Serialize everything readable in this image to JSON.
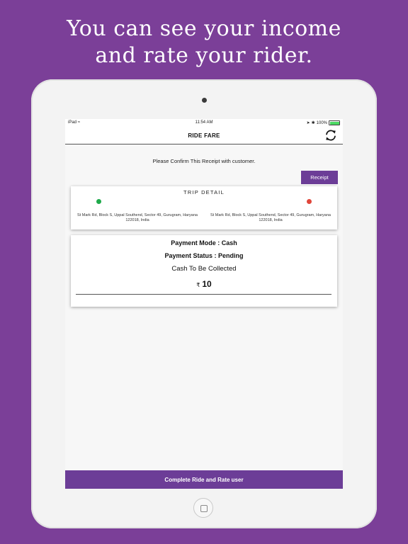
{
  "headline": {
    "line1": "You can see your income",
    "line2": "and rate your rider."
  },
  "status_bar": {
    "device": "iPad",
    "time": "11:54 AM",
    "battery": "100%"
  },
  "nav": {
    "title": "RIDE FARE",
    "refresh_icon": "refresh-icon"
  },
  "receipt": {
    "confirm_text": "Please Confirm This Receipt with customer.",
    "button_label": "Receipt"
  },
  "trip": {
    "title": "TRIP DETAIL",
    "pickup_address": "St Mark Rd, Block S, Uppal Southend, Sector 49, Gurugram, Haryana 122018, India",
    "drop_address": "St Mark Rd, Block S, Uppal Southend, Sector 49, Gurugram, Haryana 122018, India",
    "pickup_color": "#1faa4b",
    "drop_color": "#e0463a"
  },
  "payment": {
    "mode": "Payment Mode : Cash",
    "status": "Payment Status : Pending",
    "collect": "Cash To Be Collected",
    "currency": "₹",
    "amount": "10"
  },
  "footer": {
    "complete_label": "Complete Ride and Rate user"
  },
  "colors": {
    "background": "#7b3f98",
    "accent": "#6c3d97"
  }
}
